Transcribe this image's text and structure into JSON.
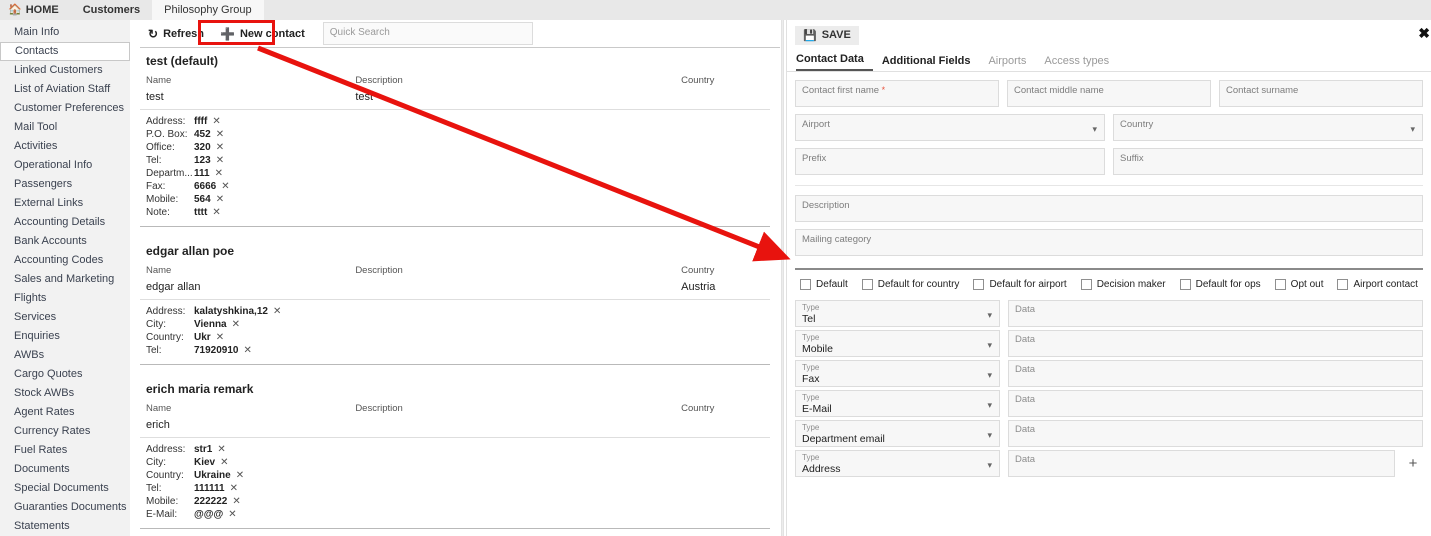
{
  "topnav": {
    "home_label": "HOME",
    "home_icon": "home-icon",
    "items": [
      {
        "label": "Customers",
        "active": false
      },
      {
        "label": "Philosophy Group",
        "active": true
      }
    ]
  },
  "sidebar": {
    "items": [
      {
        "label": "Main Info",
        "active": false
      },
      {
        "label": "Contacts",
        "active": true
      },
      {
        "label": "Linked Customers",
        "active": false
      },
      {
        "label": "List of Aviation Staff",
        "active": false
      },
      {
        "label": "Customer Preferences",
        "active": false
      },
      {
        "label": "Mail Tool",
        "active": false
      },
      {
        "label": "Activities",
        "active": false
      },
      {
        "label": "Operational Info",
        "active": false
      },
      {
        "label": "Passengers",
        "active": false
      },
      {
        "label": "External Links",
        "active": false
      },
      {
        "label": "Accounting Details",
        "active": false
      },
      {
        "label": "Bank Accounts",
        "active": false
      },
      {
        "label": "Accounting Codes",
        "active": false
      },
      {
        "label": "Sales and Marketing",
        "active": false
      },
      {
        "label": "Flights",
        "active": false
      },
      {
        "label": "Services",
        "active": false
      },
      {
        "label": "Enquiries",
        "active": false
      },
      {
        "label": "AWBs",
        "active": false
      },
      {
        "label": "Cargo Quotes",
        "active": false
      },
      {
        "label": "Stock AWBs",
        "active": false
      },
      {
        "label": "Agent Rates",
        "active": false
      },
      {
        "label": "Currency Rates",
        "active": false
      },
      {
        "label": "Fuel Rates",
        "active": false
      },
      {
        "label": "Documents",
        "active": false
      },
      {
        "label": "Special Documents",
        "active": false
      },
      {
        "label": "Guaranties Documents",
        "active": false
      },
      {
        "label": "Statements",
        "active": false
      }
    ]
  },
  "toolbar": {
    "refresh_label": "Refresh",
    "refresh_icon": "refresh-icon",
    "new_contact_label": "New contact",
    "new_contact_icon": "plus-circle-icon",
    "quick_search_placeholder": "Quick Search",
    "quick_search_value": ""
  },
  "list": {
    "columns": {
      "name": "Name",
      "description": "Description",
      "country": "Country"
    },
    "contacts": [
      {
        "title": "test (default)",
        "name": "test",
        "description": "test",
        "country": "",
        "details": [
          {
            "label": "Address:",
            "value": "ffff"
          },
          {
            "label": "P.O. Box:",
            "value": "452"
          },
          {
            "label": "Office:",
            "value": "320"
          },
          {
            "label": "Tel:",
            "value": "123"
          },
          {
            "label": "Departm...",
            "value": "111"
          },
          {
            "label": "Fax:",
            "value": "6666"
          },
          {
            "label": "Mobile:",
            "value": "564"
          },
          {
            "label": "Note:",
            "value": "tttt"
          }
        ]
      },
      {
        "title": "edgar allan poe",
        "name": "edgar allan",
        "description": "",
        "country": "Austria",
        "details": [
          {
            "label": "Address:",
            "value": "kalatyshkina,12"
          },
          {
            "label": "City:",
            "value": "Vienna"
          },
          {
            "label": "Country:",
            "value": "Ukr"
          },
          {
            "label": "Tel:",
            "value": "71920910"
          }
        ]
      },
      {
        "title": "erich maria remark",
        "name": "erich",
        "description": "",
        "country": "",
        "details": [
          {
            "label": "Address:",
            "value": "str1"
          },
          {
            "label": "City:",
            "value": "Kiev"
          },
          {
            "label": "Country:",
            "value": "Ukraine"
          },
          {
            "label": "Tel:",
            "value": "111111"
          },
          {
            "label": "Mobile:",
            "value": "222222"
          },
          {
            "label": "E-Mail:",
            "value": "@@@"
          }
        ]
      }
    ],
    "remove_icon": "close-x-icon"
  },
  "panel": {
    "save_label": "SAVE",
    "save_icon": "save-disk-icon",
    "close_icon": "close-icon",
    "close_glyph": "✖",
    "tabs": [
      {
        "label": "Contact Data",
        "state": "selected"
      },
      {
        "label": "Additional Fields",
        "state": "enabled"
      },
      {
        "label": "Airports",
        "state": "disabled"
      },
      {
        "label": "Access types",
        "state": "disabled"
      }
    ],
    "fields": {
      "first_name": {
        "placeholder": "Contact first name",
        "value": "",
        "required": true
      },
      "middle_name": {
        "placeholder": "Contact middle name",
        "value": ""
      },
      "surname": {
        "placeholder": "Contact surname",
        "value": ""
      },
      "airport": {
        "placeholder": "Airport",
        "value": ""
      },
      "country": {
        "placeholder": "Country",
        "value": ""
      },
      "prefix": {
        "placeholder": "Prefix",
        "value": ""
      },
      "suffix": {
        "placeholder": "Suffix",
        "value": ""
      },
      "description": {
        "placeholder": "Description",
        "value": ""
      },
      "mailing_category": {
        "placeholder": "Mailing category",
        "value": ""
      }
    },
    "checkboxes": [
      {
        "label": "Default",
        "checked": false
      },
      {
        "label": "Default for country",
        "checked": false
      },
      {
        "label": "Default for airport",
        "checked": false
      },
      {
        "label": "Decision maker",
        "checked": false
      },
      {
        "label": "Default for ops",
        "checked": false
      },
      {
        "label": "Opt out",
        "checked": false
      },
      {
        "label": "Airport contact",
        "checked": false
      }
    ],
    "type_caption": "Type",
    "data_placeholder": "Data",
    "add_row_label": "+",
    "type_rows": [
      {
        "type": "Tel",
        "data": ""
      },
      {
        "type": "Mobile",
        "data": ""
      },
      {
        "type": "Fax",
        "data": ""
      },
      {
        "type": "E-Mail",
        "data": ""
      },
      {
        "type": "Department email",
        "data": ""
      },
      {
        "type": "Address",
        "data": ""
      }
    ]
  },
  "annotation": {
    "accent_color": "#e8130e",
    "highlight_target": "new-contact-button",
    "arrow_from": "new-contact-button",
    "arrow_to": "contact-form-panel"
  }
}
